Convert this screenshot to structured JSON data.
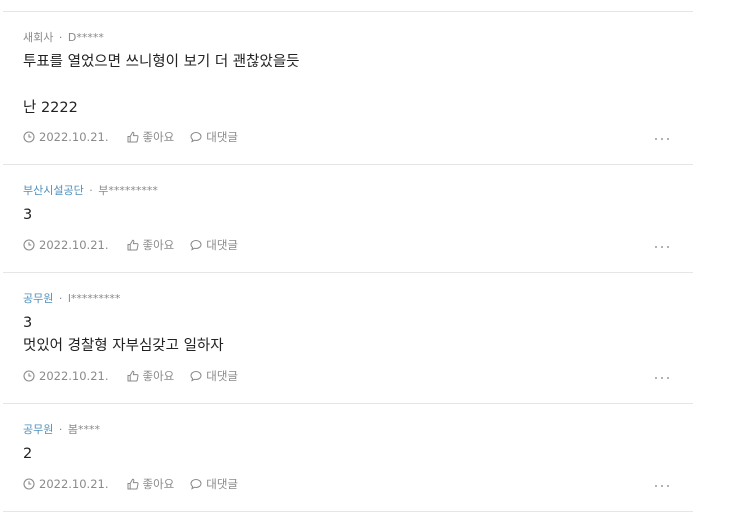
{
  "comments": [
    {
      "author": "새회사",
      "author_is_company": false,
      "user": "D*****",
      "lines": [
        "투표를 열었으면 쓰니형이 보기 더 괜찮았을듯",
        "",
        "난 2222"
      ],
      "date": "2022.10.21.",
      "like_label": "좋아요",
      "reply_label": "대댓글"
    },
    {
      "author": "부산시설공단",
      "author_is_company": true,
      "user": "부*********",
      "lines": [
        "3"
      ],
      "date": "2022.10.21.",
      "like_label": "좋아요",
      "reply_label": "대댓글"
    },
    {
      "author": "공무원",
      "author_is_company": true,
      "user": "l*********",
      "lines": [
        "3",
        "멋있어 경찰형 자부심갖고 일하자"
      ],
      "date": "2022.10.21.",
      "like_label": "좋아요",
      "reply_label": "대댓글"
    },
    {
      "author": "공무원",
      "author_is_company": true,
      "user": "봄****",
      "lines": [
        "2"
      ],
      "date": "2022.10.21.",
      "like_label": "좋아요",
      "reply_label": "대댓글"
    }
  ],
  "meta_separator": "·",
  "icons": {
    "date": "clock-icon",
    "like": "thumbs-up-icon",
    "reply": "speech-bubble-icon",
    "more": "more-horizontal-icon"
  },
  "colors": {
    "company_link": "#4d8fbe",
    "meta_text": "#8a8a8a",
    "body_text": "#222222",
    "divider": "#e5e5e5"
  }
}
